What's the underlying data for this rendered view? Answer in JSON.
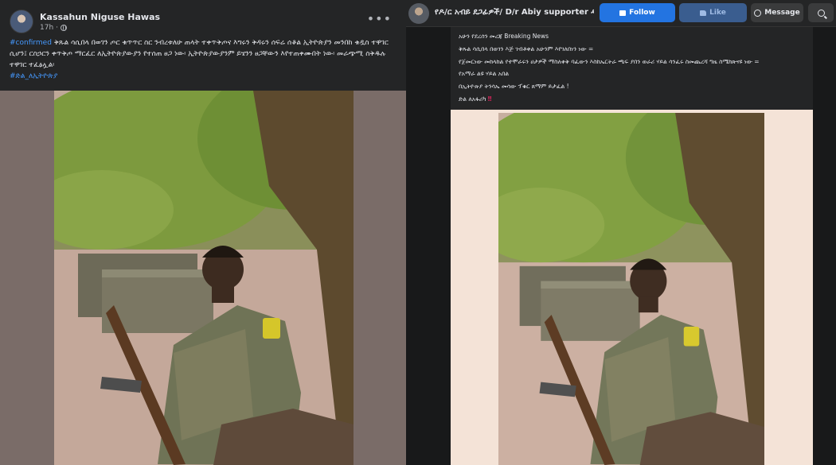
{
  "left_post": {
    "author": "Kassahun Niguse Hawas",
    "time": "17h",
    "more": "•••",
    "tag": "#confirmed",
    "body": "ቅጹል ሳሲበላ በወገን ጦር ቁጥጥር ስር ንብረቱለሁ ጠላት ተቀጥቅጦና እግሩን ቅዳሩን ሰፍሬ ሰቆል ኢትዮጵያን መንበከ ቁዷስ ተዋገር ሲሆን፤ ርስኃርን ቀጥቅጦ ማርፈር ለኢትዮጵያውያን የተሰጠ ፀጋ ነው፡ ኢትዮጵያውያንም ይሄንን ፀጋቸውን እየተጠቀሙበት ነው፡ መራጭሚ ስቅዱሉ ተዋገር ተፈፅሏል፡",
    "hashtag": "#ድል_ለኢትዮጵያ"
  },
  "right_page": {
    "name": "የዶ/ር አብይ ደጋፊዎች/ D/r Abiy supporter ዱ...",
    "follow_label": "Follow",
    "like_label": "Like",
    "message_label": "Message",
    "post_lines": [
      "አሁን የደረሰን መረጃ Breaking News",
      "ቅጹል ሳሲበላ በወገን እጅ ገብቶቀል አሁንም  እየገለበነን ነው =",
      "የጀመርነው መከላከል የተሞራሩን ሀታዎች ማስለቀቅ ባፈውን እስከኤርትራ ጫፍ ያበን ወራሪ ሃይል ሳንፈሩ ስመጨረሻ ግዜ ስሜክጽናዩ ነው =",
      "የአማራ ልዩ ሃይል አበል",
      "በኢትዮጵያ ትንሳኤ መሳው ፕቁር ጸማም ይታፈል !",
      "ድል ለአፋሪካ"
    ],
    "warn_mark": "‼"
  },
  "colors": {
    "facebook_blue": "#2374e1",
    "dark_bg": "#18191a",
    "card_bg": "#242526",
    "hashtag": "#4599ff"
  }
}
